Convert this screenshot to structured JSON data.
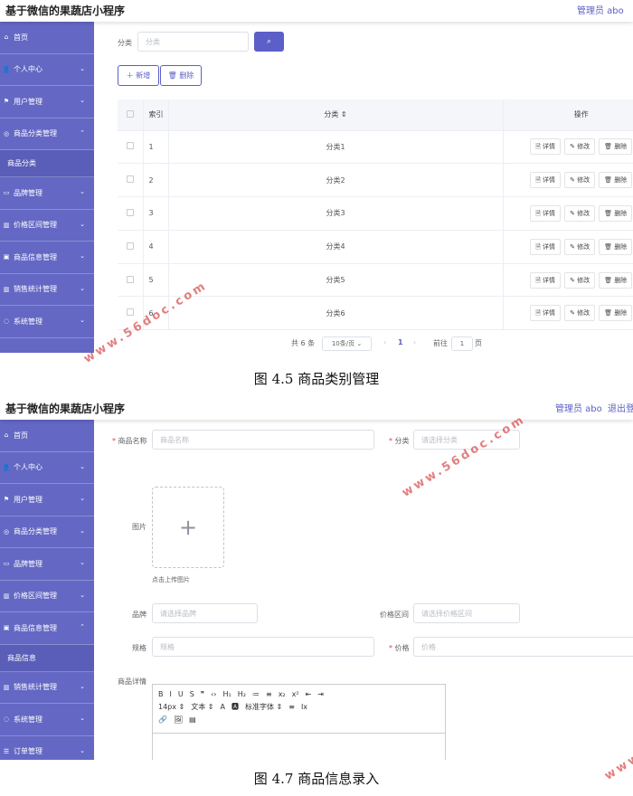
{
  "app_title": "基于微信的果蔬店小程序",
  "admin_label": "管理员 abo",
  "logout_label": "退出登",
  "shot1": {
    "menu": [
      {
        "icon": "home-icon",
        "glyph": "⌂",
        "label": "首页"
      },
      {
        "icon": "user-icon",
        "glyph": "👤",
        "label": "个人中心"
      },
      {
        "icon": "flag-icon",
        "glyph": "⚑",
        "label": "用户管理"
      },
      {
        "icon": "compass-icon",
        "glyph": "◎",
        "label": "商品分类管理",
        "expanded": true,
        "sub": "商品分类"
      },
      {
        "icon": "list-icon",
        "glyph": "▭",
        "label": "品牌管理"
      },
      {
        "icon": "chart-icon",
        "glyph": "▥",
        "label": "价格区间管理"
      },
      {
        "icon": "box-icon",
        "glyph": "▣",
        "label": "商品信息管理"
      },
      {
        "icon": "bar-chart-icon",
        "glyph": "▥",
        "label": "销售统计管理"
      },
      {
        "icon": "gear-icon",
        "glyph": "◌",
        "label": "系统管理"
      }
    ],
    "search_label": "分类",
    "search_placeholder": "分类",
    "add_label": "＋ 新增",
    "delete_label": "🗑 删除",
    "table": {
      "headers": [
        "索引",
        "分类 ⇕",
        "操作"
      ],
      "rows": [
        {
          "index": "1",
          "name": "分类1"
        },
        {
          "index": "2",
          "name": "分类2"
        },
        {
          "index": "3",
          "name": "分类3"
        },
        {
          "index": "4",
          "name": "分类4"
        },
        {
          "index": "5",
          "name": "分类5"
        },
        {
          "index": "6",
          "name": "分类6"
        }
      ],
      "actions": [
        "🗎 详情",
        "✎ 修改",
        "🗑 删除"
      ]
    },
    "pagination": {
      "total": "共 6 条",
      "page_size": "10条/页",
      "current": "1",
      "goto_label": "前往",
      "goto_value": "1",
      "page_unit": "页"
    }
  },
  "caption1": "图 4.5  商品类别管理",
  "shot2": {
    "menu": [
      {
        "icon": "home-icon",
        "glyph": "⌂",
        "label": "首页"
      },
      {
        "icon": "user-icon",
        "glyph": "👤",
        "label": "个人中心"
      },
      {
        "icon": "flag-icon",
        "glyph": "⚑",
        "label": "用户管理"
      },
      {
        "icon": "compass-icon",
        "glyph": "◎",
        "label": "商品分类管理"
      },
      {
        "icon": "list-icon",
        "glyph": "▭",
        "label": "品牌管理"
      },
      {
        "icon": "chart-icon",
        "glyph": "▥",
        "label": "价格区间管理"
      },
      {
        "icon": "box-icon",
        "glyph": "▣",
        "label": "商品信息管理",
        "expanded": true,
        "sub": "商品信息"
      },
      {
        "icon": "bar-chart-icon",
        "glyph": "▥",
        "label": "销售统计管理"
      },
      {
        "icon": "gear-icon",
        "glyph": "◌",
        "label": "系统管理"
      },
      {
        "icon": "order-icon",
        "glyph": "☰",
        "label": "订单管理"
      }
    ],
    "form": {
      "name_label": "商品名称",
      "name_placeholder": "商品名称",
      "category_label": "分类",
      "category_placeholder": "请选择分类",
      "image_label": "图片",
      "upload_hint": "点击上传图片",
      "brand_label": "品牌",
      "brand_placeholder": "请选择品牌",
      "price_range_label": "价格区间",
      "price_range_placeholder": "请选择价格区间",
      "spec_label": "规格",
      "spec_placeholder": "规格",
      "price_label": "价格",
      "price_placeholder": "价格",
      "detail_label": "商品详情",
      "toolbar_row1": [
        "B",
        "I",
        "U",
        "S",
        "❞",
        "‹›",
        "H₁",
        "H₂",
        "≔",
        "≡",
        "x₂",
        "x²",
        "⇤",
        "⇥"
      ],
      "toolbar_row2": [
        "14px ⇕",
        "文本 ⇕",
        "A",
        "🅰",
        "标准字体 ⇕",
        "≡",
        "Ix"
      ],
      "toolbar_row3": [
        "🔗",
        "🖼",
        "▤"
      ]
    }
  },
  "caption2": "图 4.7  商品信息录入",
  "watermark": "www.56doc.com"
}
